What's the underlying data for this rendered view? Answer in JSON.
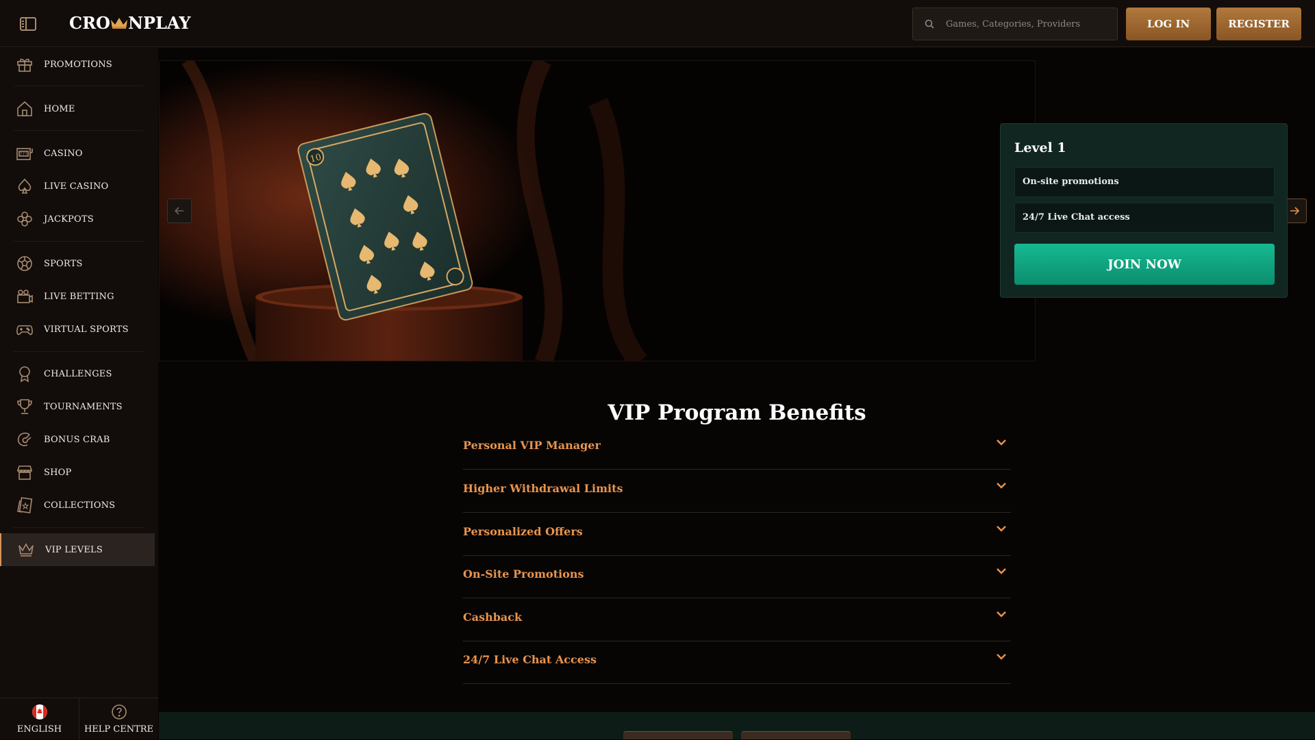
{
  "header": {
    "logo_text_pre": "CRO",
    "logo_text_post": "NPLAY",
    "search_placeholder": "Games, Categories, Providers",
    "login_label": "LOG IN",
    "register_label": "REGISTER"
  },
  "sidebar": {
    "items": [
      {
        "label": "PROMOTIONS",
        "icon": "gift-icon"
      },
      {
        "label": "HOME",
        "icon": "home-icon"
      },
      {
        "label": "CASINO",
        "icon": "slot-machine-icon"
      },
      {
        "label": "LIVE CASINO",
        "icon": "spade-icon"
      },
      {
        "label": "JACKPOTS",
        "icon": "clover-icon"
      },
      {
        "label": "SPORTS",
        "icon": "soccer-ball-icon"
      },
      {
        "label": "LIVE BETTING",
        "icon": "live-betting-icon"
      },
      {
        "label": "VIRTUAL SPORTS",
        "icon": "gamepad-icon"
      },
      {
        "label": "CHALLENGES",
        "icon": "ribbon-icon"
      },
      {
        "label": "TOURNAMENTS",
        "icon": "trophy-icon"
      },
      {
        "label": "BONUS CRAB",
        "icon": "crab-claw-icon"
      },
      {
        "label": "SHOP",
        "icon": "shop-icon"
      },
      {
        "label": "COLLECTIONS",
        "icon": "cards-icon"
      },
      {
        "label": "VIP LEVELS",
        "icon": "crown-icon",
        "active": true
      }
    ],
    "footer": {
      "language_label": "ENGLISH",
      "help_label": "HELP CENTRE"
    }
  },
  "hero": {
    "level_title": "Level 1",
    "perks": [
      "On-site promotions",
      "24/7 Live Chat access"
    ],
    "join_label": "JOIN NOW"
  },
  "benefits": {
    "title": "VIP Program Benefits",
    "items": [
      "Personal VIP Manager",
      "Higher Withdrawal Limits",
      "Personalized Offers",
      "On-Site Promotions",
      "Cashback",
      "24/7 Live Chat Access"
    ]
  },
  "colors": {
    "accent_gold": "#b0793d",
    "accent_orange_text": "#e9944e",
    "join_green": "#16b992",
    "sidebar_bg": "#120d0a"
  }
}
